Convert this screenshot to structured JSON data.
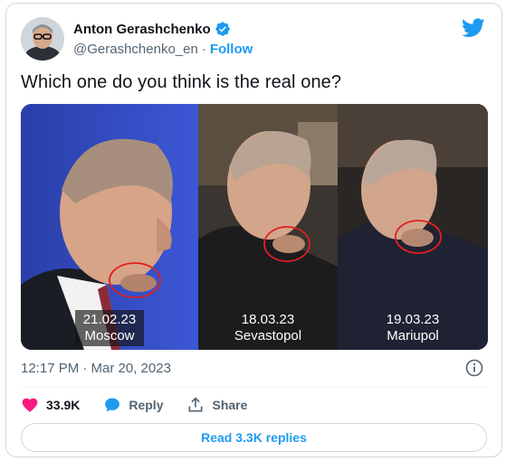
{
  "author": {
    "display_name": "Anton Gerashchenko",
    "handle": "@Gerashchenko_en",
    "separator": "·",
    "follow_label": "Follow"
  },
  "tweet": {
    "text": "Which one do you think is the real one?",
    "timestamp": "12:17 PM · Mar 20, 2023"
  },
  "media": {
    "panels": [
      {
        "date": "21.02.23",
        "place": "Moscow"
      },
      {
        "date": "18.03.23",
        "place": "Sevastopol"
      },
      {
        "date": "19.03.23",
        "place": "Mariupol"
      }
    ]
  },
  "actions": {
    "likes": "33.9K",
    "reply_label": "Reply",
    "share_label": "Share"
  },
  "replies_button": "Read 3.3K replies",
  "colors": {
    "accent": "#1d9bf0",
    "like_red": "#f91880",
    "text_secondary": "#536471",
    "circle_red": "#e02020"
  },
  "icons": [
    "verified-badge-icon",
    "twitter-bird-icon",
    "info-icon",
    "heart-icon",
    "reply-bubble-icon",
    "share-icon"
  ]
}
